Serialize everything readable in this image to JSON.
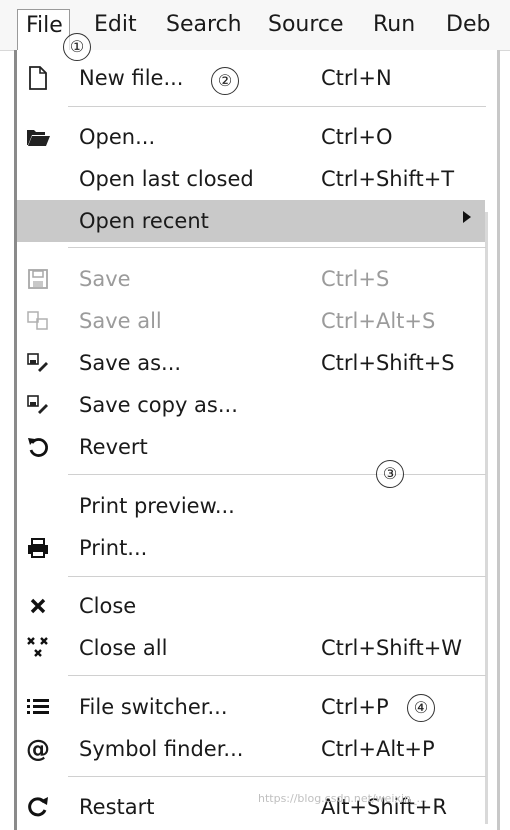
{
  "menubar": {
    "items": [
      "File",
      "Edit",
      "Search",
      "Source",
      "Run",
      "Deb"
    ]
  },
  "annotations": [
    "①",
    "②",
    "③",
    "④"
  ],
  "menu": {
    "items": [
      {
        "label": "New file...",
        "shortcut": "Ctrl+N",
        "icon": "new-file-icon"
      },
      {
        "label": "Open...",
        "shortcut": "Ctrl+O",
        "icon": "folder-open-icon"
      },
      {
        "label": "Open last closed",
        "shortcut": "Ctrl+Shift+T",
        "icon": ""
      },
      {
        "label": "Open recent",
        "shortcut": "",
        "icon": "",
        "highlighted": true,
        "submenu": true
      },
      {
        "label": "Save",
        "shortcut": "Ctrl+S",
        "icon": "save-icon",
        "disabled": true
      },
      {
        "label": "Save all",
        "shortcut": "Ctrl+Alt+S",
        "icon": "save-all-icon",
        "disabled": true
      },
      {
        "label": "Save as...",
        "shortcut": "Ctrl+Shift+S",
        "icon": "save-as-icon"
      },
      {
        "label": "Save copy as...",
        "shortcut": "",
        "icon": "save-copy-icon"
      },
      {
        "label": "Revert",
        "shortcut": "",
        "icon": "revert-icon"
      },
      {
        "label": "Print preview...",
        "shortcut": "",
        "icon": ""
      },
      {
        "label": "Print...",
        "shortcut": "",
        "icon": "print-icon"
      },
      {
        "label": "Close",
        "shortcut": "",
        "icon": "close-icon"
      },
      {
        "label": "Close all",
        "shortcut": "Ctrl+Shift+W",
        "icon": "close-all-icon"
      },
      {
        "label": "File switcher...",
        "shortcut": "Ctrl+P",
        "icon": "list-icon"
      },
      {
        "label": "Symbol finder...",
        "shortcut": "Ctrl+Alt+P",
        "icon": "at-icon"
      },
      {
        "label": "Restart",
        "shortcut": "Alt+Shift+R",
        "icon": "restart-icon"
      }
    ]
  },
  "watermark": "https://blog.csdn.net/weixin_..."
}
